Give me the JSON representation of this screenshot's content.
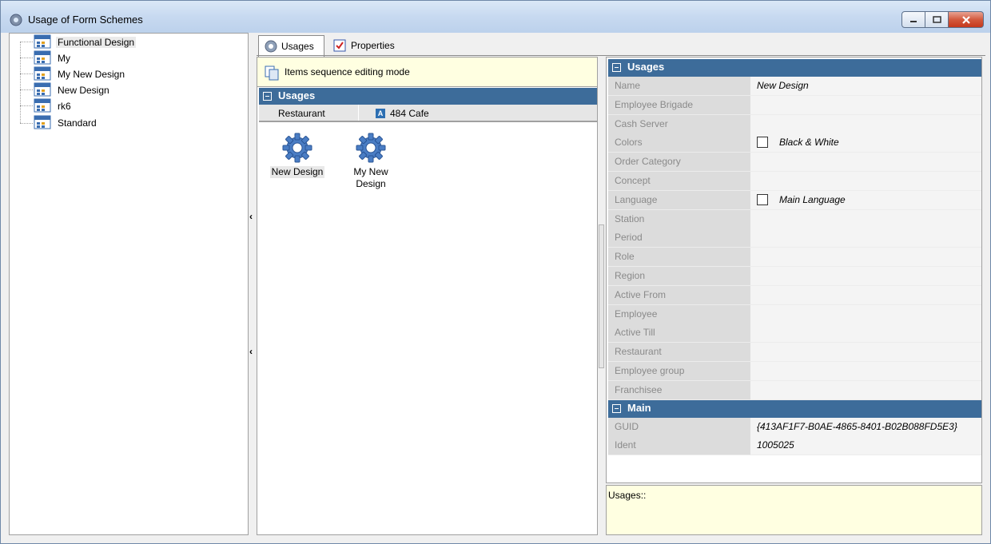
{
  "window": {
    "title": "Usage of Form Schemes"
  },
  "tree": {
    "items": [
      {
        "label": "Functional Design"
      },
      {
        "label": "My"
      },
      {
        "label": "My New Design"
      },
      {
        "label": "New Design"
      },
      {
        "label": "rk6"
      },
      {
        "label": "Standard"
      }
    ]
  },
  "tabs": [
    {
      "label": "Usages",
      "active": true
    },
    {
      "label": "Properties",
      "active": false
    }
  ],
  "middle": {
    "sequence_mode_text": "Items sequence editing mode",
    "usages_header": "Usages",
    "filter": {
      "label": "Restaurant",
      "value": "484 Cafe",
      "badge": "A"
    },
    "items": [
      {
        "label": "New Design"
      },
      {
        "label": "My New Design"
      }
    ]
  },
  "properties": {
    "usages_header": "Usages",
    "usages_rows": [
      {
        "name": "Name",
        "value": "New Design"
      },
      {
        "name": "Employee Brigade",
        "value": ""
      },
      {
        "name": "Cash Server",
        "value": ""
      },
      {
        "name": "Colors",
        "value": "Black & White",
        "checkbox": true
      },
      {
        "name": "Order Category",
        "value": ""
      },
      {
        "name": "Concept",
        "value": ""
      },
      {
        "name": "Language",
        "value": "Main Language",
        "checkbox": true
      },
      {
        "name": "Station",
        "value": ""
      },
      {
        "name": "Period",
        "value": ""
      },
      {
        "name": "Role",
        "value": ""
      },
      {
        "name": "Region",
        "value": ""
      },
      {
        "name": "Active From",
        "value": ""
      },
      {
        "name": "Employee",
        "value": ""
      },
      {
        "name": "Active Till",
        "value": ""
      },
      {
        "name": "Restaurant",
        "value": ""
      },
      {
        "name": "Employee group",
        "value": ""
      },
      {
        "name": "Franchisee",
        "value": ""
      }
    ],
    "main_header": "Main",
    "main_rows": [
      {
        "name": "GUID",
        "value": "{413AF1F7-B0AE-4865-8401-B02B088FD5E3}"
      },
      {
        "name": "Ident",
        "value": "1005025"
      }
    ]
  },
  "description": {
    "text": "Usages::"
  },
  "colors": {
    "section_header": "#3d6c9a",
    "info_bar": "#ffffe1"
  }
}
